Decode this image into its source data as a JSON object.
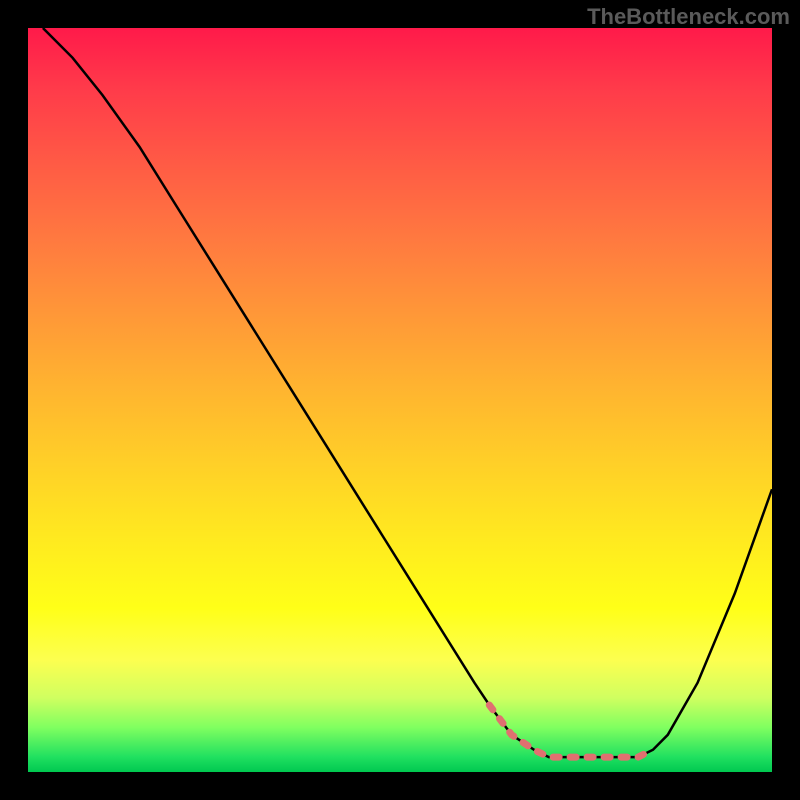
{
  "watermark": "TheBottleneck.com",
  "chart_data": {
    "type": "line",
    "title": "",
    "xlabel": "",
    "ylabel": "",
    "xlim": [
      0,
      100
    ],
    "ylim": [
      0,
      100
    ],
    "series": [
      {
        "name": "bottleneck-curve",
        "x": [
          2,
          6,
          10,
          15,
          20,
          25,
          30,
          35,
          40,
          45,
          50,
          55,
          60,
          62,
          65,
          68,
          70,
          72,
          74,
          76,
          78,
          80,
          82,
          84,
          86,
          90,
          95,
          100
        ],
        "y": [
          100,
          96,
          91,
          84,
          76,
          68,
          60,
          52,
          44,
          36,
          28,
          20,
          12,
          9,
          5,
          3,
          2,
          2,
          2,
          2,
          2,
          2,
          2,
          3,
          5,
          12,
          24,
          38
        ],
        "color": "#000000"
      },
      {
        "name": "optimal-zone-highlight",
        "x": [
          62,
          65,
          68,
          70,
          72,
          74,
          76,
          78,
          80,
          82,
          84
        ],
        "y": [
          9,
          5,
          3,
          2,
          2,
          2,
          2,
          2,
          2,
          2,
          3
        ],
        "color": "#e07070"
      }
    ],
    "gradient_stops": [
      {
        "pos": 0,
        "color": "#ff1a4a"
      },
      {
        "pos": 50,
        "color": "#ffce28"
      },
      {
        "pos": 80,
        "color": "#ffff18"
      },
      {
        "pos": 100,
        "color": "#00c850"
      }
    ]
  }
}
